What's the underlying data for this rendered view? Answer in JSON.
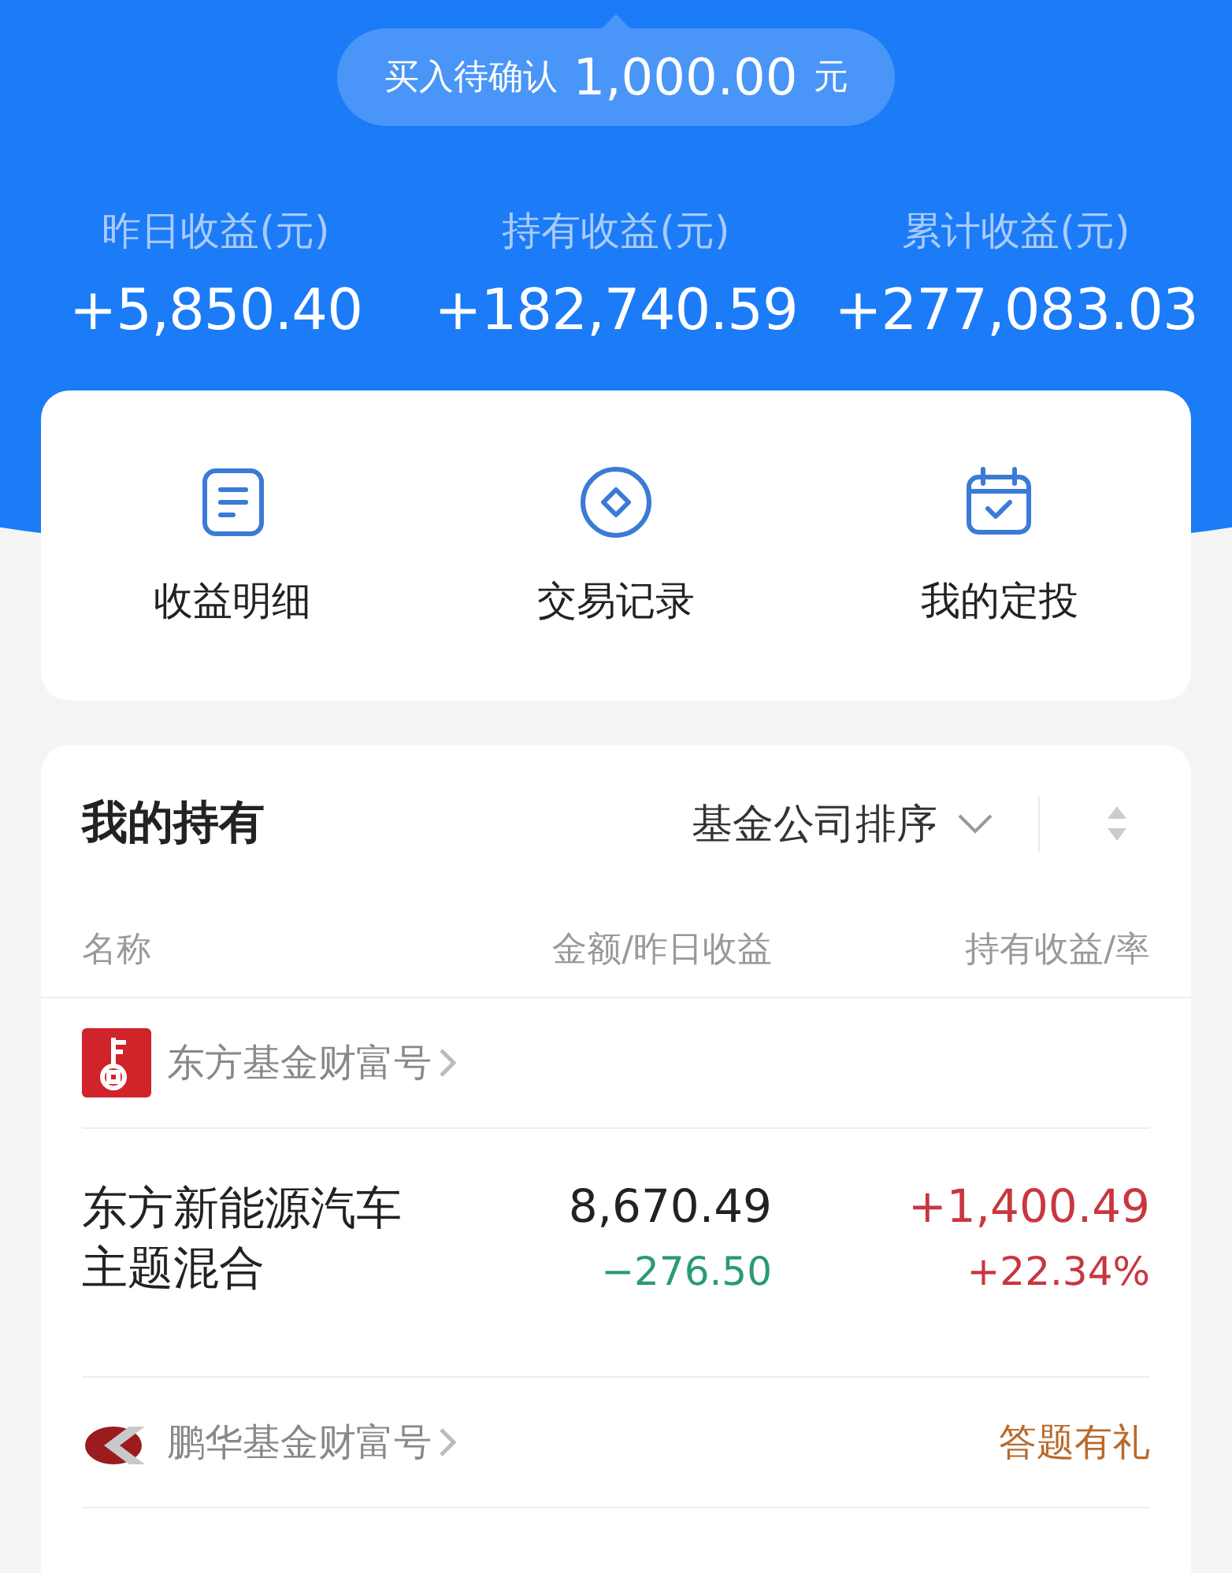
{
  "pending": {
    "label": "买入待确认",
    "amount": "1,000.00",
    "unit": "元"
  },
  "stats": [
    {
      "label": "昨日收益(元)",
      "value": "+5,850.40"
    },
    {
      "label": "持有收益(元)",
      "value": "+182,740.59"
    },
    {
      "label": "累计收益(元)",
      "value": "+277,083.03"
    }
  ],
  "actions": [
    {
      "kind": "document",
      "label": "收益明细"
    },
    {
      "kind": "coin",
      "label": "交易记录"
    },
    {
      "kind": "calendar",
      "label": "我的定投"
    }
  ],
  "holdings": {
    "title": "我的持有",
    "sort": "基金公司排序",
    "columns": [
      "名称",
      "金额/昨日收益",
      "持有收益/率"
    ],
    "companies": [
      {
        "kind": "key",
        "name": "东方基金财富号",
        "funds": [
          {
            "name": "东方新能源汽车主题混合",
            "amount": "8,670.49",
            "daily": {
              "text": "−276.50",
              "color": "#2a9a76"
            },
            "profit": {
              "text": "+1,400.49",
              "color": "#c8373f"
            },
            "rate": {
              "text": "+22.34%",
              "color": "#c8373f"
            }
          }
        ]
      },
      {
        "kind": "swoosh",
        "name": "鹏华基金财富号",
        "badge": "答题有礼"
      }
    ]
  }
}
